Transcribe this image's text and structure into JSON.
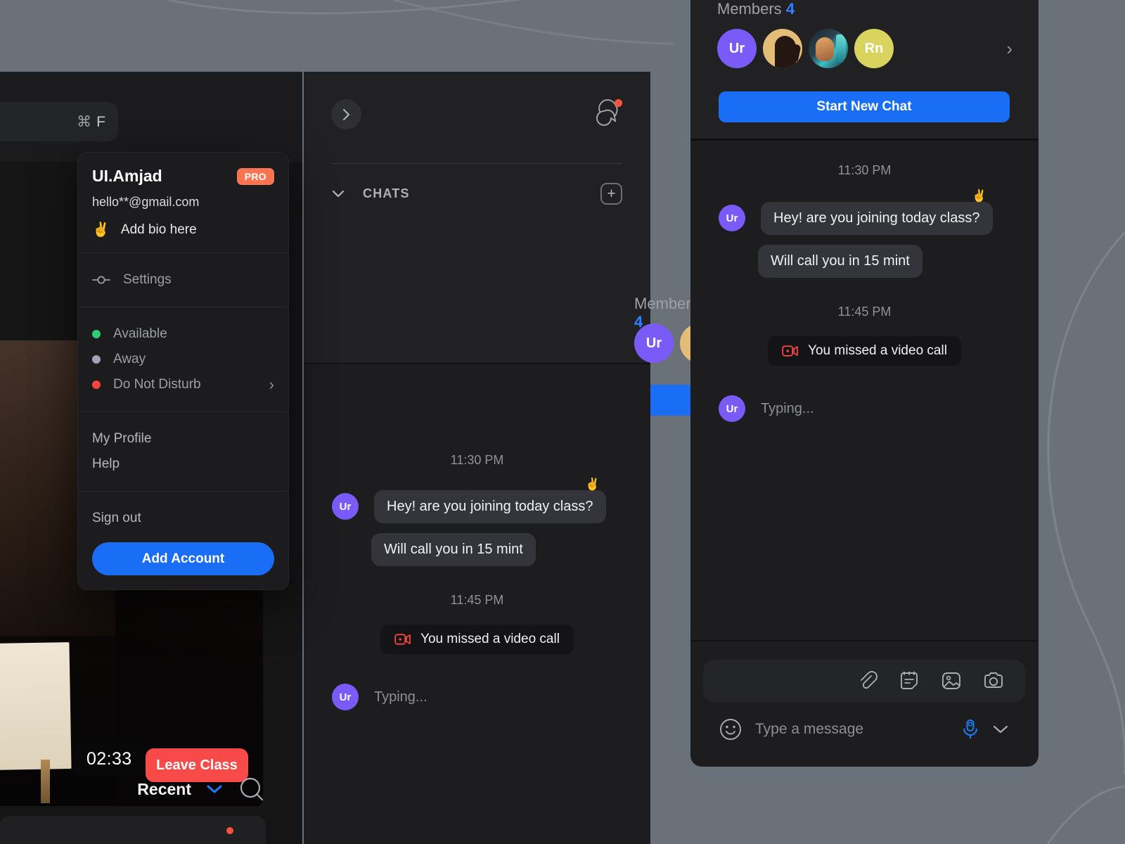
{
  "toolbar": {
    "search_shortcut_cmd": "⌘",
    "search_shortcut_key": "F",
    "mic_icon": "microphone-icon",
    "avatar_alt": "user-avatar-mask"
  },
  "account_menu": {
    "name": "UI.Amjad",
    "pro_badge": "PRO",
    "email": "hello**@gmail.com",
    "bio_emoji": "✌️",
    "bio_label": "Add bio here",
    "settings_label": "Settings",
    "statuses": [
      {
        "label": "Available",
        "color": "#2fcc71",
        "chevron": ""
      },
      {
        "label": "Away",
        "color": "#9ea3b5",
        "chevron": ""
      },
      {
        "label": "Do Not Disturb",
        "color": "#f9453f",
        "chevron": "›"
      }
    ],
    "links": [
      {
        "label": "My Profile"
      },
      {
        "label": "Help"
      }
    ],
    "sign_out_label": "Sign out",
    "add_account_label": "Add Account"
  },
  "video": {
    "timer": "02:33",
    "leave_label": "Leave Class"
  },
  "recent": {
    "label": "Recent",
    "chevron_icon": "chevron-down-icon",
    "search_icon": "search-icon"
  },
  "middle": {
    "expand_icon": "chevron-right-icon",
    "notification_icon": "chat-bubbles-icon",
    "chats_label": "CHATS",
    "chats_collapse_icon": "chevron-down-icon",
    "add_chat_icon": "plus-icon",
    "members_label": "Members",
    "members_count": "4",
    "members_chevron": "›",
    "start_new_chat_label": "Start New Chat"
  },
  "members": [
    {
      "type": "initials",
      "initials": "Ur",
      "style": "purple",
      "active": true
    },
    {
      "type": "photo",
      "style": "tan",
      "active": false
    },
    {
      "type": "photo",
      "style": "neon",
      "active": false
    },
    {
      "type": "initials",
      "initials": "Rn",
      "style": "yellow",
      "active": false
    }
  ],
  "thread": {
    "time_1": "11:30 PM",
    "time_2": "11:45 PM",
    "msg_1": "Hey! are you joining today class?",
    "msg_1_reaction": "✌️",
    "msg_2": "Will call you in 15 mint",
    "missed_call": "You missed a video call",
    "missed_call_icon": "video-camera-icon",
    "typing": "Typing...",
    "avatar_initials": "Ur"
  },
  "right_panel": {
    "members_label": "Members",
    "members_count": "4",
    "members_chevron": "›",
    "start_new_chat_label": "Start New Chat"
  },
  "compose": {
    "placeholder": "Type a message",
    "emoji_icon": "smiley-icon",
    "mic_icon": "microphone-icon",
    "collapse_icon": "chevron-down-icon",
    "attachments": [
      {
        "icon": "paperclip-icon"
      },
      {
        "icon": "note-icon"
      },
      {
        "icon": "image-icon"
      },
      {
        "icon": "camera-icon"
      }
    ]
  },
  "colors": {
    "accent_blue": "#1a6ef5",
    "danger_red": "#f94a4a",
    "pro_orange": "#f97451",
    "purple_avatar": "#7b5bf7",
    "yellow_avatar": "#d9d45e",
    "background": "#6b7178"
  }
}
